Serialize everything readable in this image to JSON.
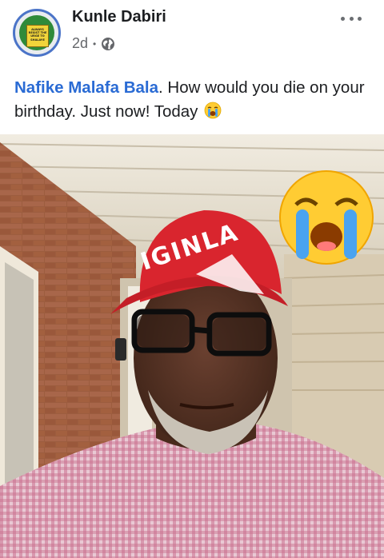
{
  "post": {
    "author": "Kunle Dabiri",
    "timestamp": "2d",
    "separator": "•",
    "privacy_icon": "globe-icon",
    "more_icon": "more-horizontal-icon",
    "avatar_sign_text": "ALWAYS RESIST THE URGE TO SHALAYE",
    "text": {
      "mention": "Nafike Malafa Bala",
      "body": ".   How would you die on your birthday.  Just now!  Today "
    },
    "inline_emoji": "loudly-crying-face",
    "photo": {
      "cap_text": "IGINLA",
      "overlay_emoji": "loudly-crying-face"
    }
  },
  "colors": {
    "mention": "#2a6bd4",
    "text": "#1c1e21",
    "meta": "#65676b",
    "cap": "#d9252e"
  }
}
